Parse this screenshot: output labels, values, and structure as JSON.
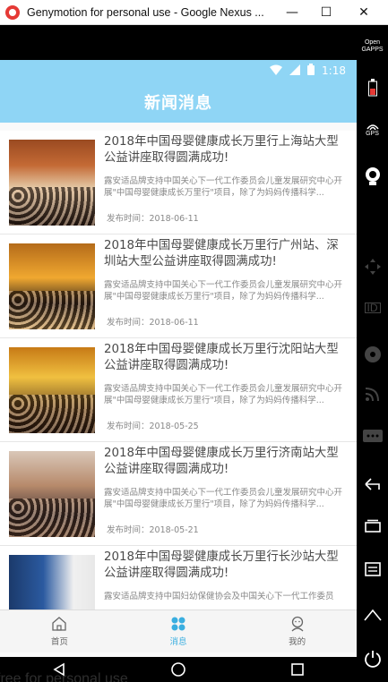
{
  "window": {
    "title": "Genymotion for personal use - Google Nexus ...",
    "minimize": "—",
    "maximize": "☐",
    "close": "✕"
  },
  "statusbar": {
    "time": "1:18"
  },
  "appbar": {
    "title": "新闻消息"
  },
  "news": [
    {
      "title": "2018年中国母婴健康成长万里行上海站大型公益讲座取得圆满成功!",
      "summary": "露安适品牌支持中国关心下一代工作委员会儿童发展研究中心开展\"中国母婴健康成长万里行\"项目，除了为妈妈传播科学...",
      "date": "发布时间：2018-06-11"
    },
    {
      "title": "2018年中国母婴健康成长万里行广州站、深圳站大型公益讲座取得圆满成功!",
      "summary": "露安适品牌支持中国关心下一代工作委员会儿童发展研究中心开展\"中国母婴健康成长万里行\"项目，除了为妈妈传播科学...",
      "date": "发布时间：2018-06-11"
    },
    {
      "title": "2018年中国母婴健康成长万里行沈阳站大型公益讲座取得圆满成功!",
      "summary": "露安适品牌支持中国关心下一代工作委员会儿童发展研究中心开展\"中国母婴健康成长万里行\"项目，除了为妈妈传播科学...",
      "date": "发布时间：2018-05-25"
    },
    {
      "title": "2018年中国母婴健康成长万里行济南站大型公益讲座取得圆满成功!",
      "summary": "露安适品牌支持中国关心下一代工作委员会儿童发展研究中心开展\"中国母婴健康成长万里行\"项目，除了为妈妈传播科学...",
      "date": "发布时间：2018-05-21"
    },
    {
      "title": "2018年中国母婴健康成长万里行长沙站大型公益讲座取得圆满成功!",
      "summary": "露安适品牌支持中国妇幼保健协会及中国关心下一代工作委员",
      "date": ""
    }
  ],
  "tabs": [
    {
      "label": "首页",
      "icon": "home-icon"
    },
    {
      "label": "消息",
      "icon": "message-icon"
    },
    {
      "label": "我的",
      "icon": "profile-icon"
    }
  ],
  "sidebar": {
    "opengapps": "Open GAPPS",
    "gps": "GPS",
    "id": "ID"
  },
  "watermark": "free for personal use",
  "colors": {
    "accent": "#8fd5f5",
    "tab_active": "#3aaee0"
  }
}
